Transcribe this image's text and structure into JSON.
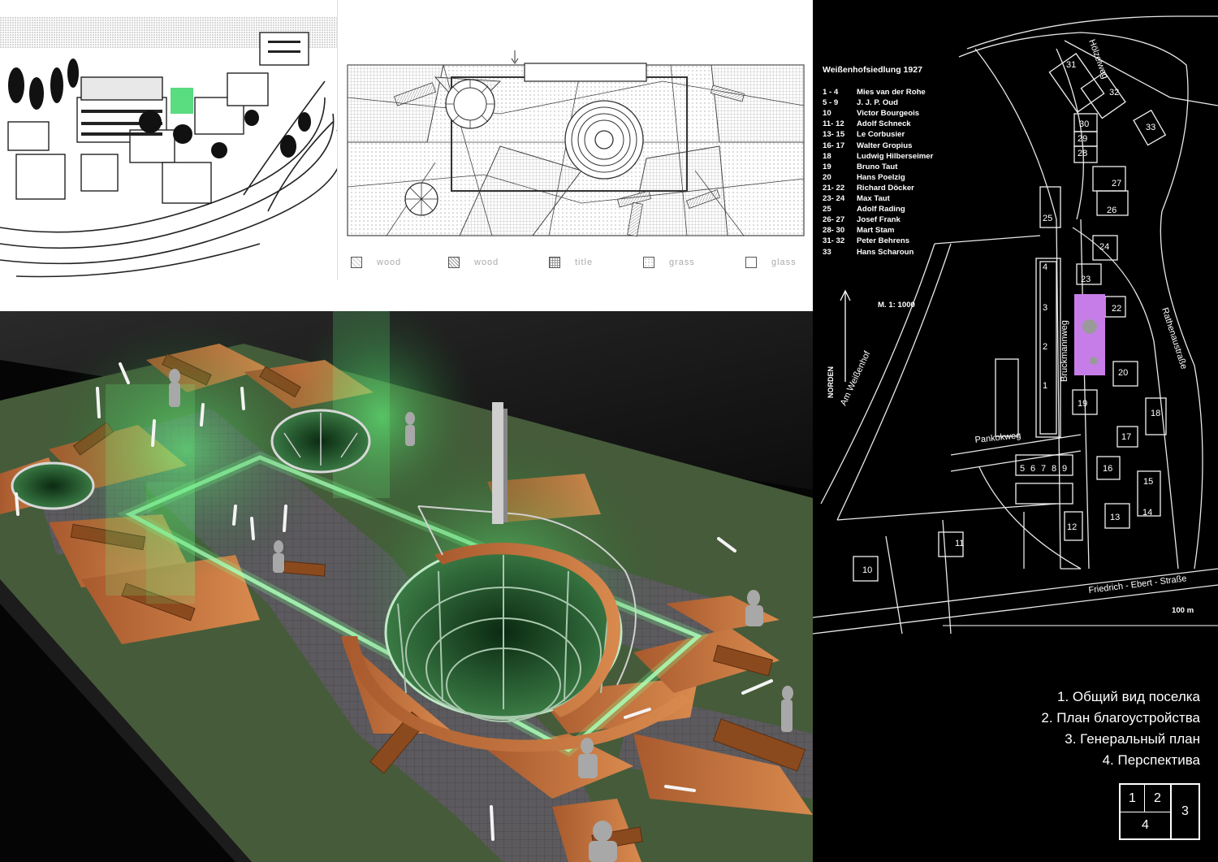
{
  "legend": [
    {
      "label": "wood",
      "pattern": "hatch-dots"
    },
    {
      "label": "wood",
      "pattern": "hatch"
    },
    {
      "label": "title",
      "pattern": "grid"
    },
    {
      "label": "grass",
      "pattern": "dots"
    },
    {
      "label": "glass",
      "pattern": "blank"
    }
  ],
  "site_plan": {
    "title": "Weißenhofsiedlung   1927",
    "architects": [
      {
        "nums": "1  -  4",
        "name": "Mies van der Rohe"
      },
      {
        "nums": "5  -  9",
        "name": "J. J. P. Oud"
      },
      {
        "nums": "10",
        "name": "Victor Bourgeois"
      },
      {
        "nums": "11- 12",
        "name": "Adolf Schneck"
      },
      {
        "nums": "13- 15",
        "name": "Le Corbusier"
      },
      {
        "nums": "16- 17",
        "name": "Walter Gropius"
      },
      {
        "nums": "18",
        "name": "Ludwig Hilberseimer"
      },
      {
        "nums": "19",
        "name": "Bruno Taut"
      },
      {
        "nums": "20",
        "name": "Hans Poelzig"
      },
      {
        "nums": "21- 22",
        "name": "Richard Döcker"
      },
      {
        "nums": "23- 24",
        "name": "Max Taut"
      },
      {
        "nums": "25",
        "name": "Adolf Rading"
      },
      {
        "nums": "26- 27",
        "name": "Josef Frank"
      },
      {
        "nums": "28- 30",
        "name": "Mart Stam"
      },
      {
        "nums": "31- 32",
        "name": "Peter Behrens"
      },
      {
        "nums": "33",
        "name": "Hans Scharoun"
      }
    ],
    "scale_label": "M. 1: 1000",
    "north_label": "NORDEN",
    "distance_label": "100 m",
    "streets": {
      "hoelzelweg": "Hölzelweg",
      "am_weissenhof": "Am Weißenhof",
      "bruckmannweg": "Bruckmannweg",
      "rathenaustrasse": "Rathenaustraße",
      "pankokweg": "Pankokweg",
      "friedrich_ebert": "Friedrich - Ebert - Straße"
    },
    "buildings": [
      "1",
      "2",
      "3",
      "4",
      "5",
      "6",
      "7",
      "8",
      "9",
      "10",
      "11",
      "12",
      "13",
      "14",
      "15",
      "16",
      "17",
      "18",
      "19",
      "20",
      "22",
      "23",
      "24",
      "25",
      "26",
      "27",
      "28",
      "29",
      "30",
      "31",
      "32",
      "33"
    ],
    "highlight_color": "#c77de8"
  },
  "captions": [
    "1. Общий вид поселка",
    "2. План благоустройства",
    "3. Генеральный план",
    "4. Перспектива"
  ],
  "key": {
    "c1": "1",
    "c2": "2",
    "c3": "3",
    "c4": "4"
  }
}
